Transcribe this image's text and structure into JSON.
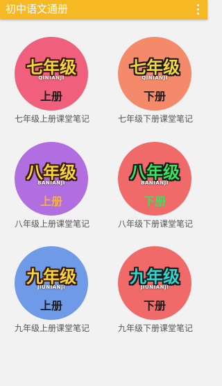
{
  "appbar": {
    "title": "初中语文通册",
    "menu_icon": "more-vert-icon",
    "color": "#f6b923"
  },
  "cards": [
    {
      "grade": "七年级",
      "pinyin": "QINIANJI",
      "volume": "上册",
      "caption": "七年级上册课堂笔记",
      "badge_color": "#f0607c",
      "grade_color": "#f7d63a",
      "outline": "#3a1a0a",
      "pinyin_color": "#ffffff",
      "volume_color": "#1a1a1a"
    },
    {
      "grade": "七年级",
      "pinyin": "QINIANJI",
      "volume": "下册",
      "caption": "七年级下册课堂笔记",
      "badge_color": "#f58a6a",
      "grade_color": "#f7d63a",
      "outline": "#1a1a1a",
      "pinyin_color": "#ffffff",
      "volume_color": "#1a1a1a"
    },
    {
      "grade": "八年级",
      "pinyin": "BANIANJI",
      "volume": "上册",
      "caption": "八年级上册课堂笔记",
      "badge_color": "#b06ee0",
      "grade_color": "#f7d63a",
      "outline": "#3a1a0a",
      "pinyin_color": "#ffffff",
      "volume_color": "#f7b23a"
    },
    {
      "grade": "八年级",
      "pinyin": "BANIANJI",
      "volume": "下册",
      "caption": "八年级下册课堂笔记",
      "badge_color": "#f06a6a",
      "grade_color": "#36e35a",
      "outline": "#1a1a1a",
      "pinyin_color": "#ffffff",
      "volume_color": "#36e35a"
    },
    {
      "grade": "九年级",
      "pinyin": "JIUNIANJI",
      "volume": "上册",
      "caption": "九年级上册课堂笔记",
      "badge_color": "#6f9ae8",
      "grade_color": "#f7d63a",
      "outline": "#3a1a0a",
      "pinyin_color": "#ffffff",
      "volume_color": "#1a1a1a"
    },
    {
      "grade": "九年级",
      "pinyin": "JIUNIANJI",
      "volume": "下册",
      "caption": "九年级下册课堂笔记",
      "badge_color": "#f06a6a",
      "grade_color": "#2fd6d0",
      "outline": "#1a1a1a",
      "pinyin_color": "#ffffff",
      "volume_color": "#1a1a1a"
    }
  ]
}
